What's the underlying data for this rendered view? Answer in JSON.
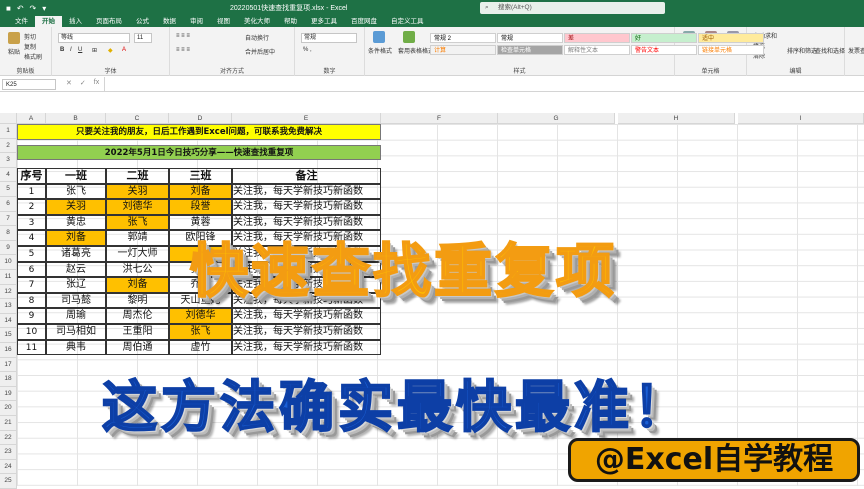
{
  "titlebar": {
    "autosave": "自动保存",
    "doc_title": "20220501快速查找重复项.xlsx - Excel",
    "search_placeholder": "搜索(Alt+Q)"
  },
  "menu": [
    "文件",
    "开始",
    "插入",
    "页面布局",
    "公式",
    "数据",
    "审阅",
    "视图",
    "美化大师",
    "帮助",
    "更多工具",
    "百度网盘",
    "自定义工具"
  ],
  "ribbon": {
    "clipboard": {
      "paste": "粘贴",
      "cut": "剪切",
      "copy": "复制",
      "format_painter": "格式刷",
      "label": "剪贴板"
    },
    "font": {
      "name": "等线",
      "size": "11",
      "label": "字体"
    },
    "alignment": {
      "wrap": "自动换行",
      "merge": "合并后居中",
      "label": "对齐方式"
    },
    "number": {
      "format": "常规",
      "label": "数字"
    },
    "styles": {
      "cond": "条件格式",
      "table": "套用表格格式",
      "cells": [
        {
          "t": "常规 2",
          "bg": "#ffffff",
          "c": "#000"
        },
        {
          "t": "常规",
          "bg": "#ffffff",
          "c": "#000"
        },
        {
          "t": "差",
          "bg": "#ffc7ce",
          "c": "#9c0006"
        },
        {
          "t": "好",
          "bg": "#c6efce",
          "c": "#006100"
        },
        {
          "t": "适中",
          "bg": "#ffeb9c",
          "c": "#9c5700"
        },
        {
          "t": "计算",
          "bg": "#f2f2f2",
          "c": "#fa7d00"
        },
        {
          "t": "检查单元格",
          "bg": "#a5a5a5",
          "c": "#ffffff"
        },
        {
          "t": "解释性文本",
          "bg": "#ffffff",
          "c": "#7f7f7f"
        },
        {
          "t": "警告文本",
          "bg": "#ffffff",
          "c": "#ff0000"
        },
        {
          "t": "链接单元格",
          "bg": "#ffffff",
          "c": "#fa7d00"
        }
      ],
      "label": "样式"
    },
    "cells": {
      "insert": "插入",
      "delete": "删除",
      "format": "格式",
      "label": "单元格"
    },
    "editing": {
      "autosum": "自动求和",
      "fill": "填充",
      "clear": "清除",
      "sort": "排序和筛选",
      "find": "查找和选择",
      "label": "编辑"
    },
    "extra": "发票查验"
  },
  "formula": {
    "namebox": "K25",
    "fx": "fx"
  },
  "columns": [
    "A",
    "B",
    "C",
    "D",
    "E",
    "F",
    "G",
    "H",
    "I"
  ],
  "rows": [
    "1",
    "2",
    "3",
    "4",
    "5",
    "6",
    "7",
    "8",
    "9",
    "10",
    "11",
    "12",
    "13",
    "14",
    "15",
    "16",
    "17",
    "18",
    "19",
    "20",
    "21",
    "22",
    "23",
    "24",
    "25"
  ],
  "sheet": {
    "banner1": "只要关注我的朋友，日后工作遇到Excel问题，可联系我免费解决",
    "banner2": "2022年5月1日今日技巧分享——快速查找重复项",
    "headers": [
      "序号",
      "一班",
      "二班",
      "三班",
      "备注"
    ],
    "table": [
      [
        "1",
        "张飞",
        "关羽",
        "刘备",
        "关注我，每天学新技巧新函数"
      ],
      [
        "2",
        "关羽",
        "刘德华",
        "段誉",
        "关注我，每天学新技巧新函数"
      ],
      [
        "3",
        "黄忠",
        "张飞",
        "黄蓉",
        "关注我，每天学新技巧新函数"
      ],
      [
        "4",
        "刘备",
        "郭靖",
        "欧阳锋",
        "关注我，每天学新技巧新函数"
      ],
      [
        "5",
        "诸葛亮",
        "一灯大师",
        "",
        "关注我，每天学新技巧新函数"
      ],
      [
        "6",
        "赵云",
        "洪七公",
        "张飞",
        "关注我，每天学新技巧新函数"
      ],
      [
        "7",
        "张辽",
        "刘备",
        "乔峰",
        "关注我，每天学新技巧新函数"
      ],
      [
        "8",
        "司马懿",
        "黎明",
        "天山童姥",
        "关注我，每天学新技巧新函数"
      ],
      [
        "9",
        "周瑜",
        "周杰伦",
        "刘德华",
        "关注我，每天学新技巧新函数"
      ],
      [
        "10",
        "司马相如",
        "王重阳",
        "张飞",
        "关注我，每天学新技巧新函数"
      ],
      [
        "11",
        "典韦",
        "周伯通",
        "虚竹",
        "关注我，每天学新技巧新函数"
      ]
    ],
    "highlight": [
      [
        0,
        1,
        1
      ],
      [
        1,
        1,
        1
      ],
      [
        0,
        1,
        0
      ],
      [
        1,
        0,
        0
      ],
      [
        0,
        0,
        1
      ],
      [
        0,
        0,
        0
      ],
      [
        0,
        1,
        0
      ],
      [
        0,
        0,
        0
      ],
      [
        0,
        0,
        1
      ],
      [
        0,
        0,
        1
      ],
      [
        0,
        0,
        0
      ]
    ]
  },
  "overlay": {
    "title": "快速查找重复项",
    "subtitle": "这方法确实最快最准！",
    "brand": "@Excel自学教程"
  }
}
